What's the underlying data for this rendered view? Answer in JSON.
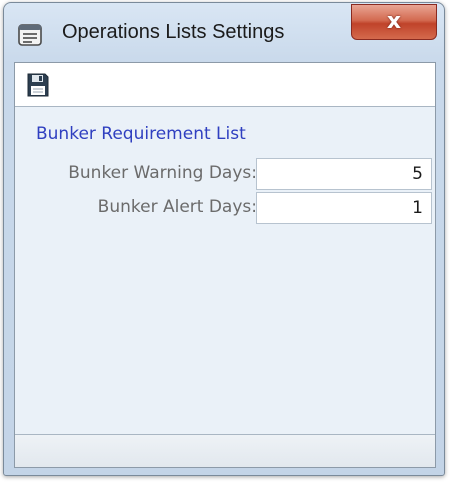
{
  "window": {
    "title": "Operations Lists Settings",
    "close_label": "x"
  },
  "toolbar": {
    "save_icon": "save-icon"
  },
  "section": {
    "title": "Bunker Requirement List"
  },
  "fields": [
    {
      "label": "Bunker Warning Days:",
      "value": "5"
    },
    {
      "label": "Bunker Alert Days:",
      "value": "1"
    }
  ],
  "colors": {
    "section_title": "#2f3fc0",
    "label_text": "#6b6b6b",
    "close_button": "#c9553b"
  }
}
